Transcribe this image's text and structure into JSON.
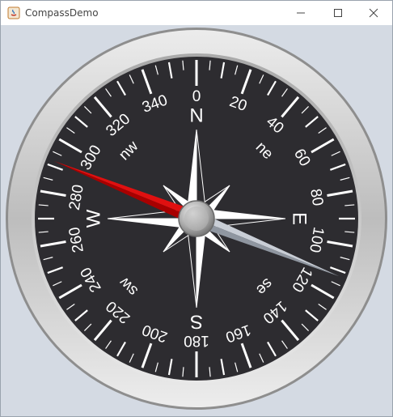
{
  "window": {
    "title": "CompassDemo",
    "controls": {
      "minimize_icon": "minimize-icon",
      "maximize_icon": "maximize-icon",
      "close_icon": "close-icon"
    }
  },
  "compass": {
    "heading_degrees": 292,
    "degree_labels": [
      "0",
      "20",
      "40",
      "60",
      "80",
      "100",
      "120",
      "140",
      "160",
      "180",
      "200",
      "220",
      "240",
      "260",
      "280",
      "300",
      "320",
      "340"
    ],
    "cardinals": {
      "north": "N",
      "east": "E",
      "south": "S",
      "west": "W"
    },
    "intercardinals": {
      "ne": "ne",
      "se": "se",
      "sw": "sw",
      "nw": "nw"
    },
    "colors": {
      "dial_face": "#2d2c30",
      "bezel_outer": "#8e8e8e",
      "bezel_inner": "#cfcfcf",
      "needle_north": "#e01010",
      "needle_south": "#c9ced6",
      "background": "#d4dae3"
    }
  }
}
